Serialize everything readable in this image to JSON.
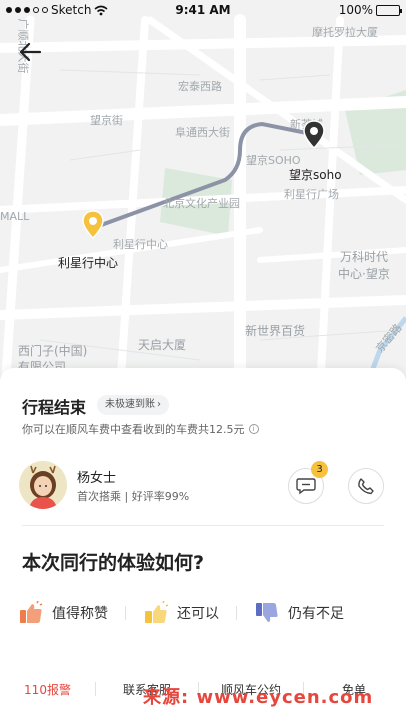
{
  "status_bar": {
    "carrier": "Sketch",
    "time": "9:41 AM",
    "battery": "100%",
    "battery_level": 1.0
  },
  "map": {
    "labels": [
      "摩托罗拉大厦",
      "宏泰西路",
      "望京街",
      "阜通西大街",
      "望京SOHO",
      "新荟城",
      "利星行广场",
      "北京文化产业园",
      "MALL",
      "利星行中心",
      "万科时代",
      "中心·望京",
      "新世界百货",
      "天启大厦",
      "西门子(中国)",
      "有限公司",
      "京密路",
      "广顺北大街"
    ],
    "start_pin": {
      "label": "利星行中心",
      "color": "#f6c23e"
    },
    "end_pin": {
      "label": "望京soho",
      "color": "#333333"
    },
    "route_color": "#8d93a6"
  },
  "trip": {
    "title": "行程结束",
    "badge": "未极速到账",
    "badge_chevron": "›",
    "note": "你可以在顺风车费中查看收到的车费共12.5元"
  },
  "driver": {
    "name": "杨女士",
    "meta": "首次搭乘 | 好评率99%",
    "unread_messages": "3"
  },
  "rating": {
    "question": "本次同行的体验如何?",
    "options": [
      "值得称赞",
      "还可以",
      "仍有不足"
    ]
  },
  "bottom_nav": [
    "110报警",
    "联系客服",
    "顺风车公约",
    "免单"
  ],
  "watermark": "来源: www.eycen.com",
  "colors": {
    "accent": "#f6c23e",
    "alert": "#e6463c"
  }
}
